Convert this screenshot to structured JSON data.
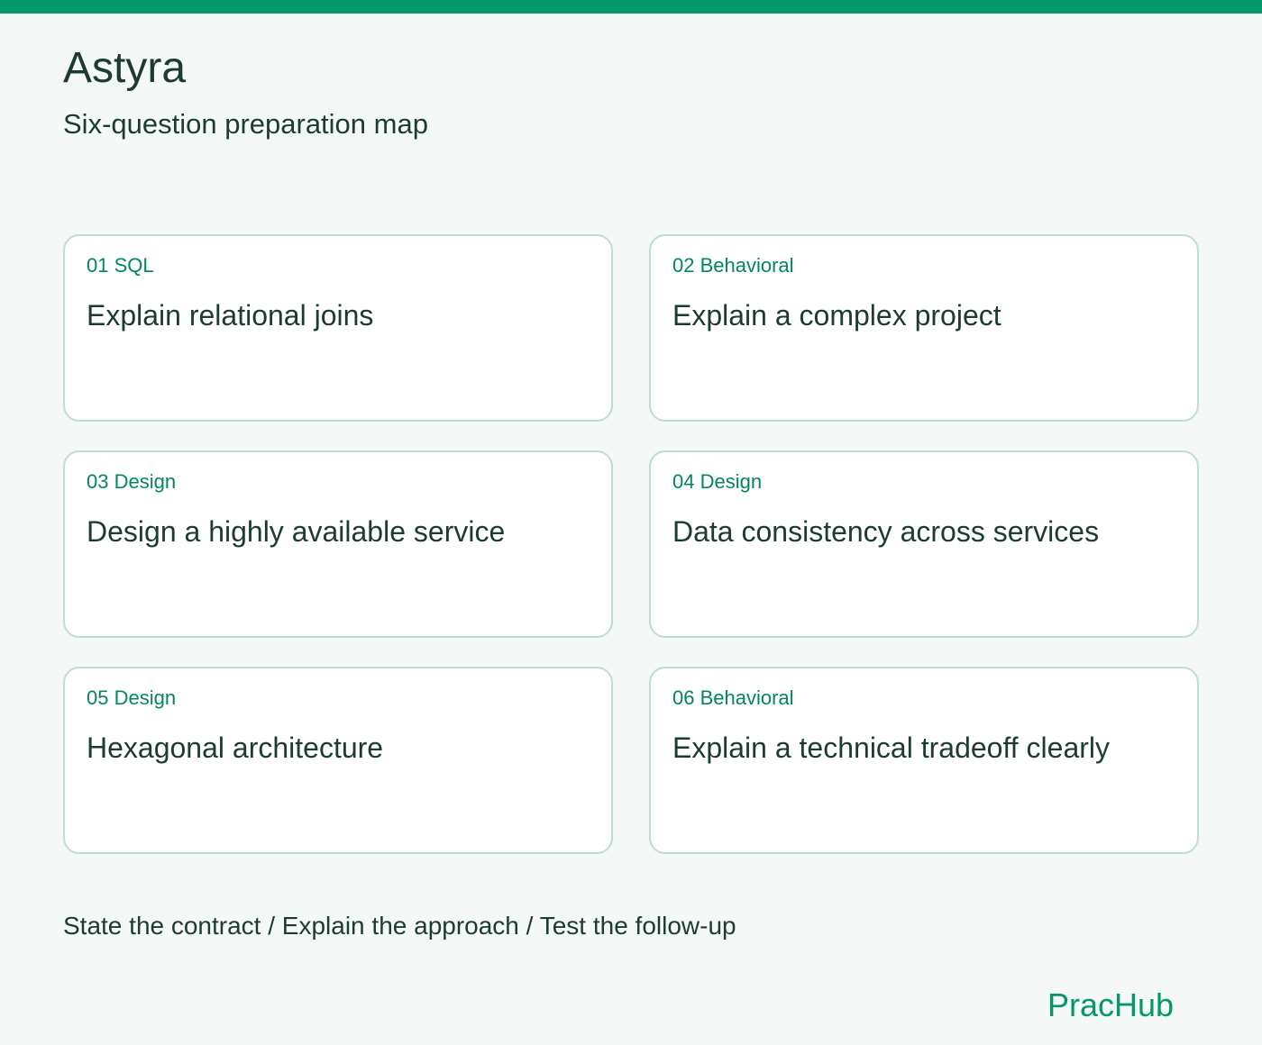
{
  "header": {
    "title": "Astyra",
    "subtitle": "Six-question preparation map"
  },
  "questions": [
    {
      "tag": "01 SQL",
      "title": "Explain relational joins"
    },
    {
      "tag": "02 Behavioral",
      "title": "Explain a complex project"
    },
    {
      "tag": "03 Design",
      "title": "Design a highly available service"
    },
    {
      "tag": "04 Design",
      "title": "Data consistency across services"
    },
    {
      "tag": "05 Design",
      "title": "Hexagonal architecture"
    },
    {
      "tag": "06 Behavioral",
      "title": "Explain a technical tradeoff clearly"
    }
  ],
  "footer": {
    "steps": "State the contract / Explain the approach / Test the follow-up",
    "brand": "PracHub"
  },
  "colors": {
    "accent": "#05976c",
    "background": "#f4f8f6",
    "text": "#1d3b34",
    "card_border": "#bfdcd2"
  }
}
